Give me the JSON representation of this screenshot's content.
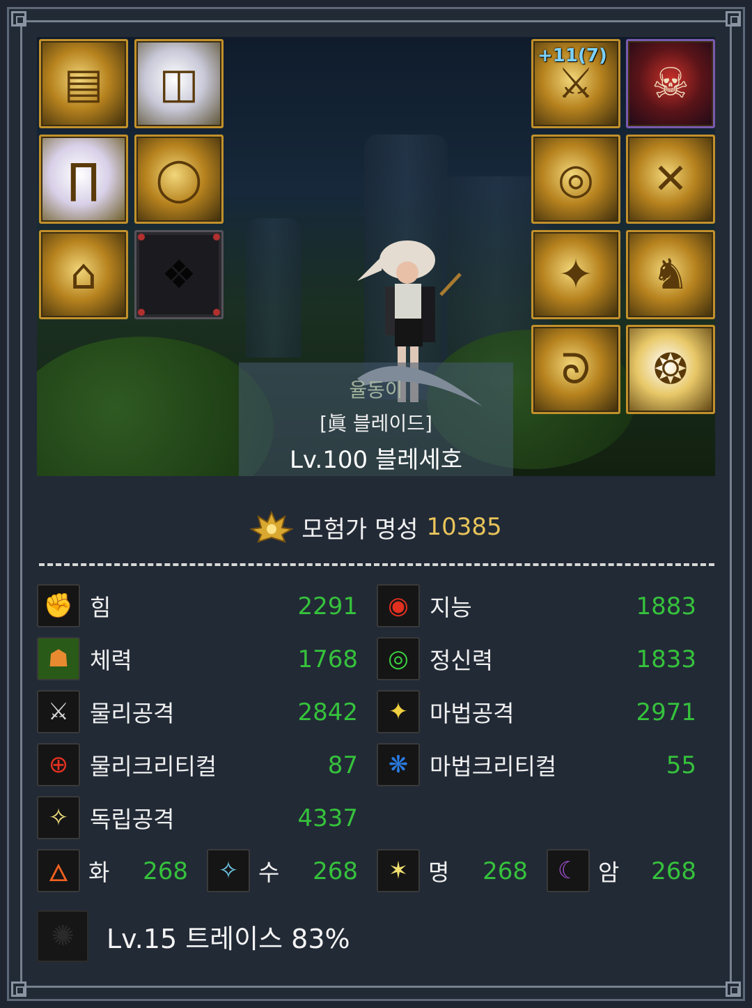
{
  "equipment": {
    "weapon_reinforce": "+11(7)",
    "left_slots": [
      {
        "icon": "shoulder-armor-icon"
      },
      {
        "icon": "top-armor-icon"
      },
      {
        "icon": "pants-icon"
      },
      {
        "icon": "belt-icon"
      },
      {
        "icon": "boots-icon"
      },
      {
        "icon": "empty-pet-paw-icon"
      }
    ],
    "right_slots": [
      {
        "icon": "weapon-icon"
      },
      {
        "icon": "title-skull-icon"
      },
      {
        "icon": "bracelet-icon"
      },
      {
        "icon": "necklace-icon"
      },
      {
        "icon": "ring-icon"
      },
      {
        "icon": "support-icon"
      },
      {
        "icon": "magic-stone-icon"
      },
      {
        "icon": "earring-icon"
      }
    ]
  },
  "character": {
    "name": "율동이",
    "title": "[眞 블레이드]",
    "level_class": "Lv.100 블레세호"
  },
  "fame": {
    "label": "모험가 명성",
    "value": "10385",
    "icon": "fame-crest-icon",
    "color": "#e8c45a"
  },
  "stats": [
    {
      "label": "힘",
      "value": "2291",
      "icon": "strength-icon"
    },
    {
      "label": "지능",
      "value": "1883",
      "icon": "intelligence-icon"
    },
    {
      "label": "체력",
      "value": "1768",
      "icon": "vitality-icon"
    },
    {
      "label": "정신력",
      "value": "1833",
      "icon": "spirit-icon"
    },
    {
      "label": "물리공격",
      "value": "2842",
      "icon": "physical-attack-icon"
    },
    {
      "label": "마법공격",
      "value": "2971",
      "icon": "magic-attack-icon"
    },
    {
      "label": "물리크리티컬",
      "value": "87",
      "icon": "physical-critical-icon"
    },
    {
      "label": "마법크리티컬",
      "value": "55",
      "icon": "magic-critical-icon"
    },
    {
      "label": "독립공격",
      "value": "4337",
      "icon": "independent-attack-icon"
    }
  ],
  "elements": [
    {
      "label": "화",
      "value": "268",
      "icon": "fire-element-icon"
    },
    {
      "label": "수",
      "value": "268",
      "icon": "water-element-icon"
    },
    {
      "label": "명",
      "value": "268",
      "icon": "light-element-icon"
    },
    {
      "label": "암",
      "value": "268",
      "icon": "dark-element-icon"
    }
  ],
  "trace": {
    "text": "Lv.15 트레이스 83%",
    "icon": "trace-icon"
  },
  "colors": {
    "stat_value": "#36c23c",
    "fame_value": "#e8c45a",
    "frame": "#76808e"
  }
}
